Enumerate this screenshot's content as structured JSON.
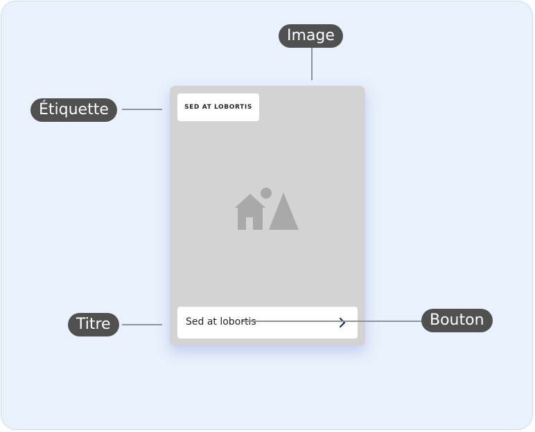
{
  "callouts": {
    "image": "Image",
    "etiquette": "Étiquette",
    "titre": "Titre",
    "bouton": "Bouton"
  },
  "card": {
    "tag_label": "SED AT LOBORTIS",
    "title": "Sed at lobortis",
    "image_icon": "image-placeholder-icon",
    "button_icon": "chevron-right-icon"
  },
  "colors": {
    "background": "#e8f1fc",
    "callout": "#505050",
    "card": "#d3d3d3",
    "chevron": "#1b2d6b"
  }
}
